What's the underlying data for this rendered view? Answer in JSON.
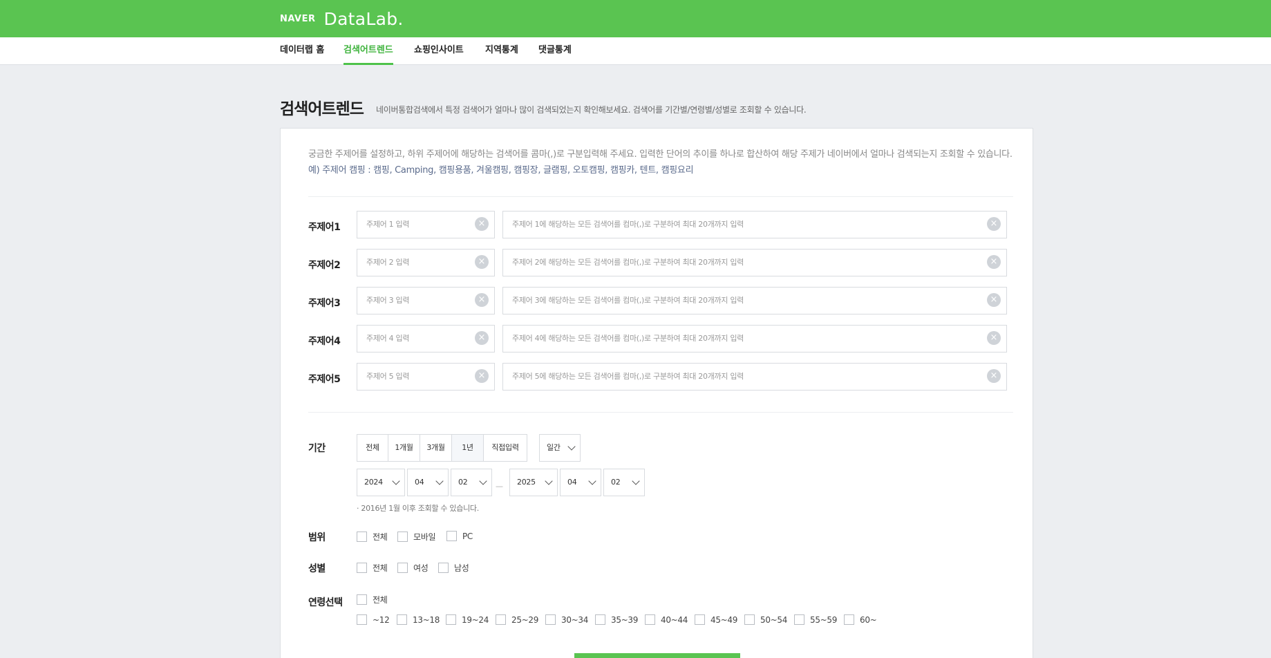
{
  "header": {
    "logo_naver": "NAVER",
    "logo_datalab": "DataLab."
  },
  "nav": {
    "items": [
      {
        "label": "데이터랩 홈"
      },
      {
        "label": "검색어트렌드"
      },
      {
        "label": "쇼핑인사이트"
      },
      {
        "label": "지역통계"
      },
      {
        "label": "댓글통계"
      }
    ],
    "active": "검색어트렌드"
  },
  "page": {
    "title": "검색어트렌드",
    "description": "네이버통합검색에서 특정 검색어가 얼마나 많이 검색되었는지 확인해보세요. 검색어를 기간별/연령별/성별로 조회할 수 있습니다."
  },
  "guide": {
    "text": "궁금한 주제어를 설정하고, 하위 주제어에 해당하는 검색어를 콤마(,)로 구분입력해 주세요. 입력한 단어의 추이를 하나로 합산하여 해당 주제가 네이버에서 얼마나 검색되는지 조회할 수 있습니다.",
    "example": "예) 주제어 캠핑 : 캠핑, Camping, 캠핑용품, 겨울캠핑, 캠핑장, 글램핑, 오토캠핑, 캠핑카, 텐트, 캠핑요리"
  },
  "keywords": [
    {
      "label": "주제어1",
      "name_placeholder": "주제어 1 입력",
      "terms_placeholder": "주제어 1에 해당하는 모든 검색어를 컴마(,)로 구분하여 최대 20개까지 입력"
    },
    {
      "label": "주제어2",
      "name_placeholder": "주제어 2 입력",
      "terms_placeholder": "주제어 2에 해당하는 모든 검색어를 컴마(,)로 구분하여 최대 20개까지 입력"
    },
    {
      "label": "주제어3",
      "name_placeholder": "주제어 3 입력",
      "terms_placeholder": "주제어 3에 해당하는 모든 검색어를 컴마(,)로 구분하여 최대 20개까지 입력"
    },
    {
      "label": "주제어4",
      "name_placeholder": "주제어 4 입력",
      "terms_placeholder": "주제어 4에 해당하는 모든 검색어를 컴마(,)로 구분하여 최대 20개까지 입력"
    },
    {
      "label": "주제어5",
      "name_placeholder": "주제어 5 입력",
      "terms_placeholder": "주제어 5에 해당하는 모든 검색어를 컴마(,)로 구분하여 최대 20개까지 입력"
    }
  ],
  "period": {
    "label": "기간",
    "buttons": [
      "전체",
      "1개월",
      "3개월",
      "1년",
      "직접입력"
    ],
    "selected": "1년",
    "interval": "일간",
    "start": {
      "year": "2024",
      "month": "04",
      "day": "02"
    },
    "end": {
      "year": "2025",
      "month": "04",
      "day": "02"
    },
    "separator": "—",
    "note": "· 2016년 1월 이후 조회할 수 있습니다."
  },
  "scope": {
    "label": "범위",
    "options": [
      "전체",
      "모바일",
      "PC"
    ]
  },
  "gender": {
    "label": "성별",
    "options": [
      "전체",
      "여성",
      "남성"
    ]
  },
  "age": {
    "label": "연령선택",
    "all": "전체",
    "options": [
      "~12",
      "13~18",
      "19~24",
      "25~29",
      "30~34",
      "35~39",
      "40~44",
      "45~49",
      "50~54",
      "55~59",
      "60~"
    ]
  },
  "colors": {
    "brand": "#5ac451",
    "active_tab": "#3eb33c",
    "background": "#eceef1"
  }
}
